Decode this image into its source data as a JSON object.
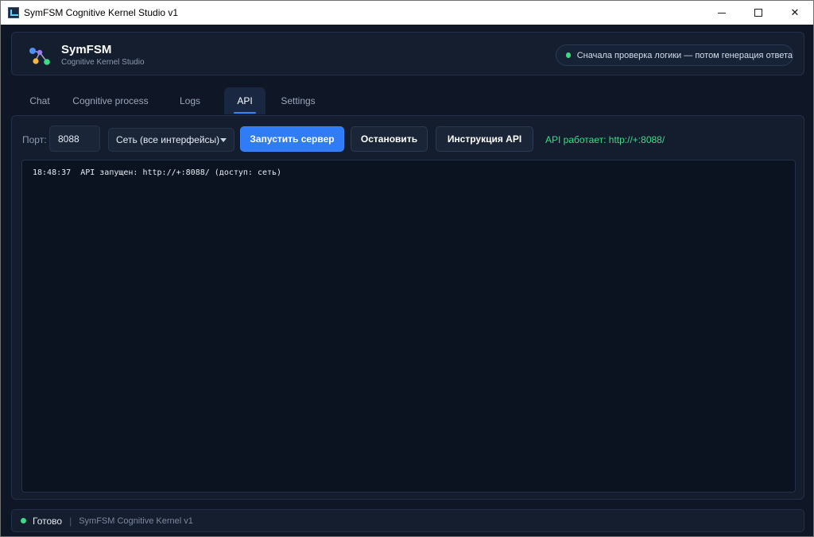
{
  "window": {
    "title": "SymFSM Cognitive Kernel Studio v1",
    "controls": {
      "minimize": "",
      "maximize": "",
      "close": "✕"
    }
  },
  "header": {
    "brand_name": "SymFSM",
    "brand_subtitle": "Cognitive Kernel Studio",
    "hint": "Сначала проверка логики — потом генерация ответа",
    "hint_dot_color": "#3ddc84"
  },
  "tabs": [
    {
      "label": "Chat",
      "active": false
    },
    {
      "label": "Cognitive process",
      "active": false
    },
    {
      "label": "Logs",
      "active": false
    },
    {
      "label": "API",
      "active": true
    },
    {
      "label": "Settings",
      "active": false
    }
  ],
  "api_panel": {
    "port_label": "Порт:",
    "port_value": "8088",
    "network_select": {
      "selected": "Сеть (все интерфейсы)"
    },
    "start_button": "Запустить сервер",
    "stop_button": "Остановить",
    "docs_button": "Инструкция API",
    "status": "API работает: http://+:8088/",
    "log_lines": [
      "18:48:37  API запущен: http://+:8088/ (доступ: сеть)"
    ]
  },
  "footer": {
    "status": "Готово",
    "separator": "|",
    "version": "SymFSM Cognitive Kernel v1"
  },
  "colors": {
    "accent": "#2f7cf6",
    "success": "#3ddc84",
    "background": "#0f1726"
  }
}
